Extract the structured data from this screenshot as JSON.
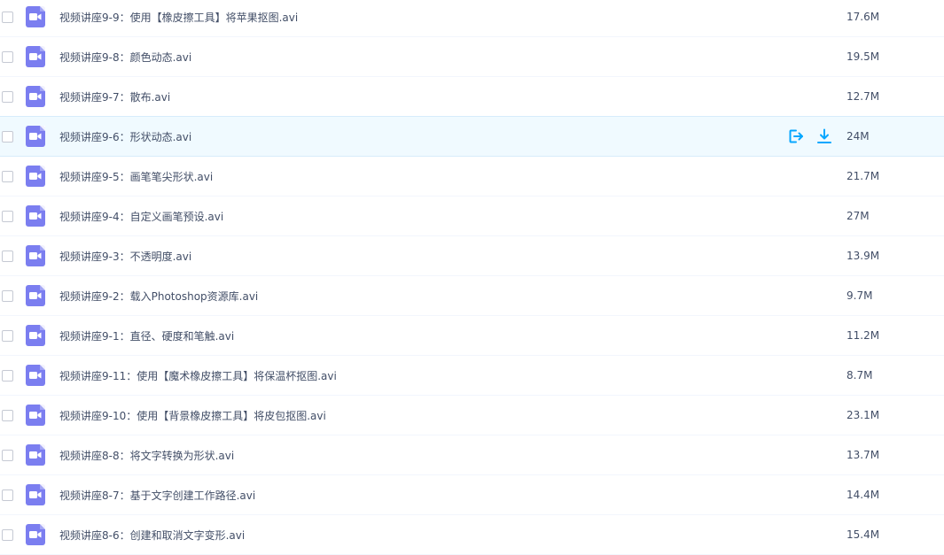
{
  "colors": {
    "video_icon": "#7b7ef0",
    "action_icon": "#06a7ff",
    "hover_row": "#f0faff"
  },
  "files": [
    {
      "name": "视频讲座9-9：使用【橡皮擦工具】将苹果抠图.avi",
      "size": "17.6M"
    },
    {
      "name": "视频讲座9-8：颜色动态.avi",
      "size": "19.5M"
    },
    {
      "name": "视频讲座9-7：散布.avi",
      "size": "12.7M"
    },
    {
      "name": "视频讲座9-6：形状动态.avi",
      "size": "24M"
    },
    {
      "name": "视频讲座9-5：画笔笔尖形状.avi",
      "size": "21.7M"
    },
    {
      "name": "视频讲座9-4：自定义画笔预设.avi",
      "size": "27M"
    },
    {
      "name": "视频讲座9-3：不透明度.avi",
      "size": "13.9M"
    },
    {
      "name": "视频讲座9-2：载入Photoshop资源库.avi",
      "size": "9.7M"
    },
    {
      "name": "视频讲座9-1：直径、硬度和笔触.avi",
      "size": "11.2M"
    },
    {
      "name": "视频讲座9-11：使用【魔术橡皮擦工具】将保温杯抠图.avi",
      "size": "8.7M"
    },
    {
      "name": "视频讲座9-10：使用【背景橡皮擦工具】将皮包抠图.avi",
      "size": "23.1M"
    },
    {
      "name": "视频讲座8-8：将文字转换为形状.avi",
      "size": "13.7M"
    },
    {
      "name": "视频讲座8-7：基于文字创建工作路径.avi",
      "size": "14.4M"
    },
    {
      "name": "视频讲座8-6：创建和取消文字变形.avi",
      "size": "15.4M"
    }
  ],
  "hover_row_actions": [
    "share-icon",
    "download-icon"
  ]
}
